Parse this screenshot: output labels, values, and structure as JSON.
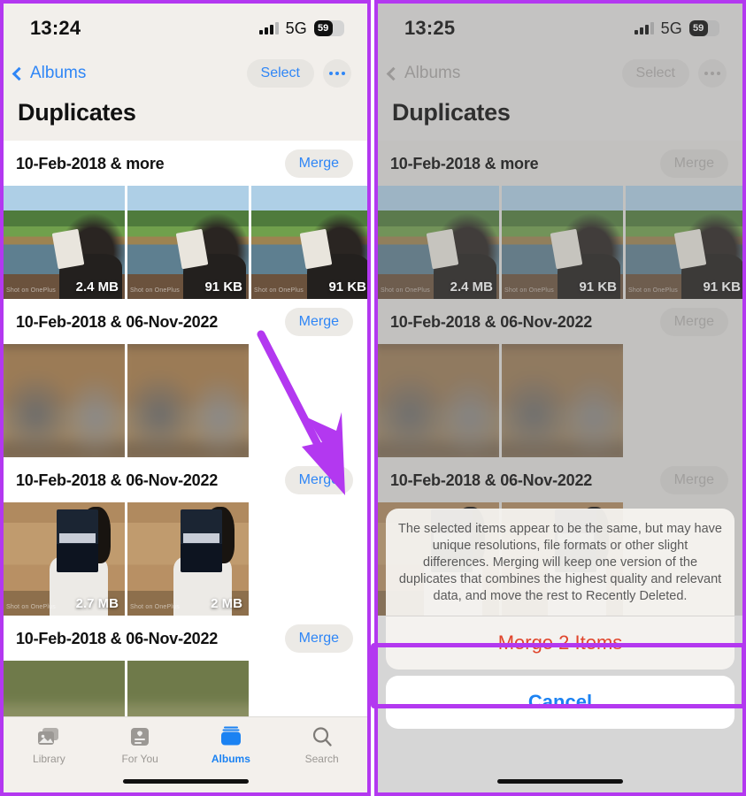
{
  "left_phone": {
    "status_bar": {
      "time": "13:24",
      "network": "5G",
      "battery_percent": "59"
    },
    "nav": {
      "back_label": "Albums",
      "select_label": "Select",
      "more_label": "more-options"
    },
    "title": "Duplicates",
    "groups": [
      {
        "title": "10-Feb-2018 & more",
        "merge_label": "Merge",
        "photos": [
          {
            "size": "2.4 MB",
            "watermark": "Shot on OnePlus",
            "kind": "lake"
          },
          {
            "size": "91 KB",
            "watermark": "Shot on OnePlus",
            "kind": "lake"
          },
          {
            "size": "91 KB",
            "watermark": "Shot on OnePlus",
            "kind": "lake"
          }
        ]
      },
      {
        "title": "10-Feb-2018 & 06-Nov-2022",
        "merge_label": "Merge",
        "photos": [
          {
            "size": "",
            "watermark": "",
            "kind": "blur"
          },
          {
            "size": "",
            "watermark": "",
            "kind": "blur"
          }
        ]
      },
      {
        "title": "10-Feb-2018 & 06-Nov-2022",
        "merge_label": "Merge",
        "photos": [
          {
            "size": "2.7 MB",
            "watermark": "Shot on OnePlus",
            "kind": "book"
          },
          {
            "size": "2 MB",
            "watermark": "Shot on OnePlus",
            "kind": "book"
          }
        ]
      },
      {
        "title": "10-Feb-2018 & 06-Nov-2022",
        "merge_label": "Merge",
        "photos": [
          {
            "size": "",
            "watermark": "",
            "kind": "green"
          },
          {
            "size": "",
            "watermark": "",
            "kind": "green"
          }
        ]
      }
    ],
    "tabs": [
      {
        "label": "Library",
        "icon": "photos-stack-icon",
        "active": false
      },
      {
        "label": "For You",
        "icon": "for-you-card-icon",
        "active": false
      },
      {
        "label": "Albums",
        "icon": "albums-book-icon",
        "active": true
      },
      {
        "label": "Search",
        "icon": "magnifier-icon",
        "active": false
      }
    ]
  },
  "right_phone": {
    "status_bar": {
      "time": "13:25",
      "network": "5G",
      "battery_percent": "59"
    },
    "nav": {
      "back_label": "Albums",
      "select_label": "Select",
      "more_label": "more-options"
    },
    "title": "Duplicates",
    "groups": [
      {
        "title": "10-Feb-2018 & more",
        "merge_label": "Merge",
        "photos": [
          {
            "size": "2.4 MB",
            "watermark": "Shot on OnePlus",
            "kind": "lake"
          },
          {
            "size": "91 KB",
            "watermark": "Shot on OnePlus",
            "kind": "lake"
          },
          {
            "size": "91 KB",
            "watermark": "Shot on OnePlus",
            "kind": "lake"
          }
        ]
      },
      {
        "title": "10-Feb-2018 & 06-Nov-2022",
        "merge_label": "Merge",
        "photos": [
          {
            "size": "",
            "watermark": "",
            "kind": "blur"
          },
          {
            "size": "",
            "watermark": "",
            "kind": "blur"
          }
        ]
      },
      {
        "title": "10-Feb-2018 & 06-Nov-2022",
        "merge_label": "Merge",
        "photos": [
          {
            "size": "",
            "watermark": "",
            "kind": "book"
          },
          {
            "size": "",
            "watermark": "",
            "kind": "book"
          }
        ]
      }
    ],
    "action_sheet": {
      "message": "The selected items appear to be the same, but may have unique resolutions, file formats or other slight differences. Merging will keep one version of the duplicates that combines the highest quality and relevant data, and move the rest to Recently Deleted.",
      "confirm_label": "Merge 2 Items",
      "cancel_label": "Cancel"
    }
  },
  "annotations": {
    "highlight_color": "#b338f0",
    "arrow_color": "#b338f0",
    "arrow_name": "merge-button-pointer-arrow"
  }
}
